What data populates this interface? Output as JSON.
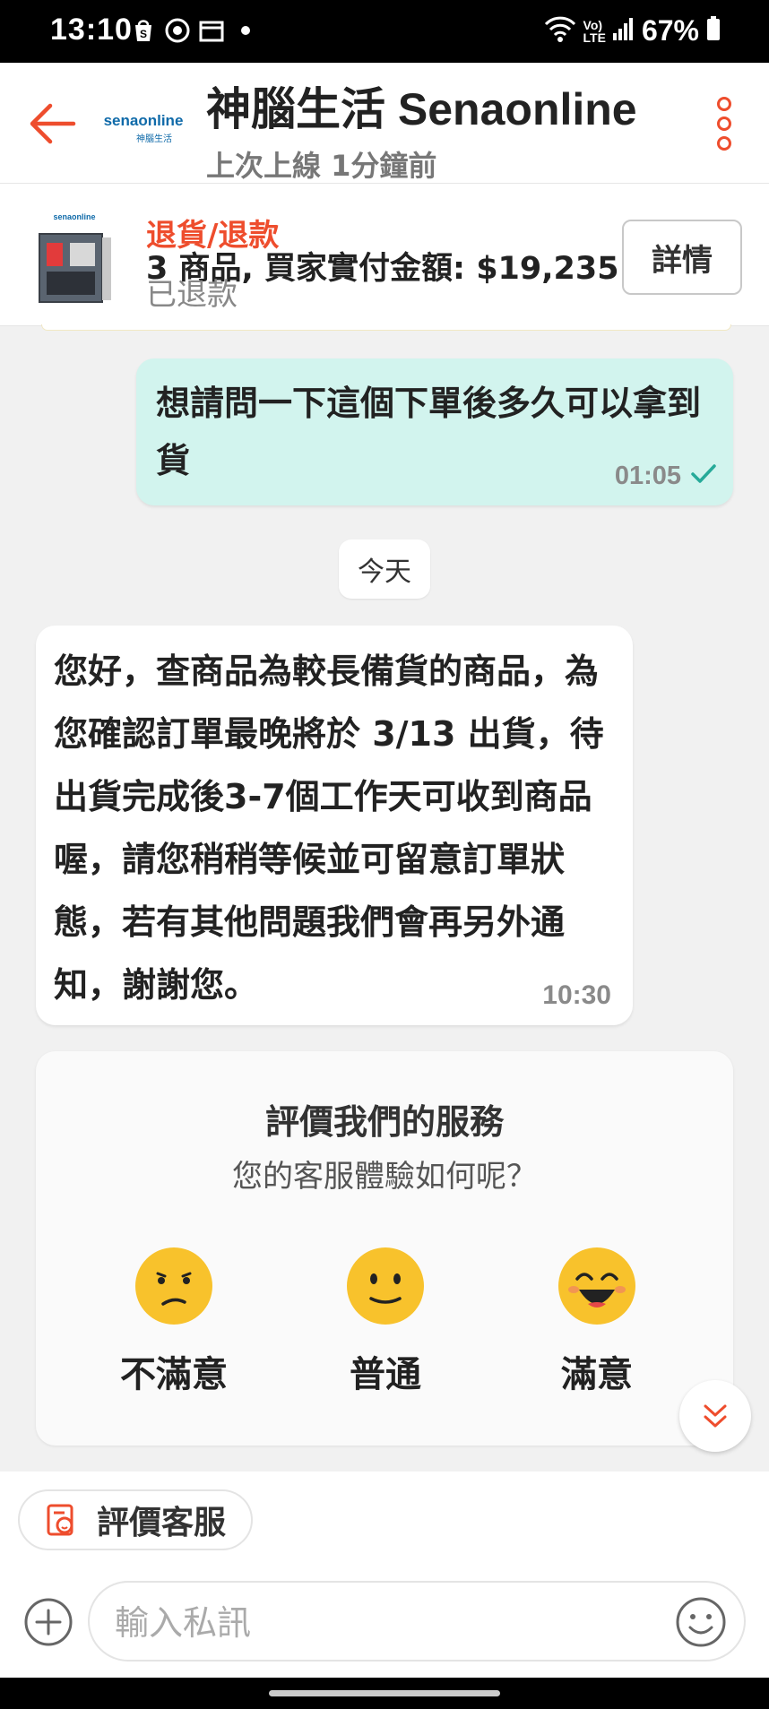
{
  "status_bar": {
    "time": "13:10",
    "battery": "67%",
    "network": "LTE"
  },
  "header": {
    "shop_name": "神腦生活 Senaonline",
    "last_online": "上次上線 1分鐘前",
    "logo_text": "senaonline",
    "logo_subtext": "神腦生活"
  },
  "order": {
    "status": "退貨/退款",
    "summary": "3 商品, 買家實付金額: $19,235",
    "refund_status": "已退款",
    "detail_button": "詳情"
  },
  "messages": [
    {
      "direction": "outgoing",
      "text": "想請問一下這個下單後多久可以拿到貨",
      "time": "01:05"
    },
    {
      "direction": "incoming",
      "text": "您好，查商品為較長備貨的商品，為您確認訂單最晚將於 3/13 出貨，待出貨完成後3-7個工作天可收到商品喔，請您稍稍等候並可留意訂單狀態，若有其他問題我們會再另外通知，謝謝您。",
      "time": "10:30"
    }
  ],
  "date_separator": "今天",
  "rating": {
    "title": "評價我們的服務",
    "subtitle": "您的客服體驗如何呢？",
    "options": [
      {
        "label": "不滿意",
        "icon": "sad-face-icon"
      },
      {
        "label": "普通",
        "icon": "neutral-face-icon"
      },
      {
        "label": "滿意",
        "icon": "happy-face-icon"
      }
    ]
  },
  "bottom": {
    "rate_chip": "評價客服",
    "input_placeholder": "輸入私訊"
  },
  "colors": {
    "accent": "#ee4d2d",
    "outgoing_bubble": "#d2f4ee",
    "emoji_yellow": "#f8c22c",
    "check_green": "#26aa99"
  }
}
